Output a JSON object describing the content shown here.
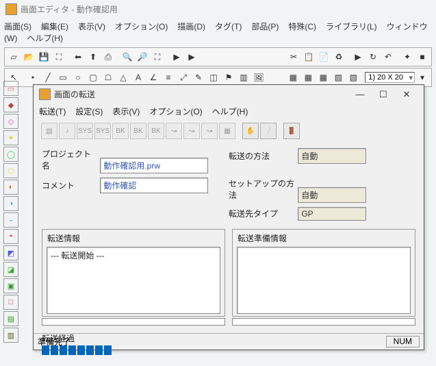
{
  "app": {
    "title": "画面エディタ - 動作確認用"
  },
  "menu": [
    "画面(S)",
    "編集(E)",
    "表示(V)",
    "オプション(O)",
    "描画(D)",
    "タグ(T)",
    "部品(P)",
    "特殊(C)",
    "ライブラリ(L)",
    "ウィンドウ(W)",
    "ヘルプ(H)"
  ],
  "combo_size": "1) 20 X 20",
  "modal": {
    "title": "画面の転送",
    "menu": [
      "転送(T)",
      "設定(S)",
      "表示(V)",
      "オプション(O)",
      "ヘルプ(H)"
    ],
    "fields": {
      "project_lbl": "プロジェクト名",
      "project_val": "動作確認用.prw",
      "comment_lbl": "コメント",
      "comment_val": "動作確認",
      "method_lbl": "転送の方法",
      "method_val": "自動",
      "setup_lbl": "セットアップの方法",
      "setup_val": "自動",
      "dest_lbl": "転送先タイプ",
      "dest_val": "GP"
    },
    "info_title": "転送情報",
    "info_text": "--- 転送開始 ---",
    "prep_title": "転送準備情報",
    "progress_lbl": "転送経過",
    "status": "準備完了",
    "num": "NUM"
  },
  "icons": {
    "new": "▱",
    "open": "📂",
    "save": "💾",
    "fit": "⛶",
    "undo1": "⬅",
    "undo2": "⬆",
    "print": "⎙",
    "zoomin": "🔍",
    "zoomout": "🔎",
    "zoomrect": "⛶",
    "play1": "▶",
    "play2": "▶",
    "cut": "✂",
    "copy": "📋",
    "paste": "📄",
    "sync": "♻",
    "player": "▶",
    "ref1": "↻",
    "ref2": "↶",
    "star": "✦",
    "stop": "■",
    "arrow": "↖",
    "dot": "•",
    "line": "╱",
    "rect": "▭",
    "circ": "○",
    "rrect": "▢",
    "poly": "☖",
    "tri": "△",
    "text": "A",
    "angle": "∠",
    "fill": "≡",
    "scale": "⤢",
    "pen": "✎",
    "sel": "◫",
    "flag": "⚑",
    "pic": "▥",
    "img": "🖼",
    "palette": [
      "▭",
      "◆",
      "◇",
      "●",
      "◯",
      "⬡",
      "◐",
      "◑",
      "◒",
      "◓",
      "◩",
      "◪",
      "▣",
      "□",
      "▤",
      "▥"
    ],
    "hand": "✋",
    "q": "❔",
    "exit": "🚪"
  }
}
